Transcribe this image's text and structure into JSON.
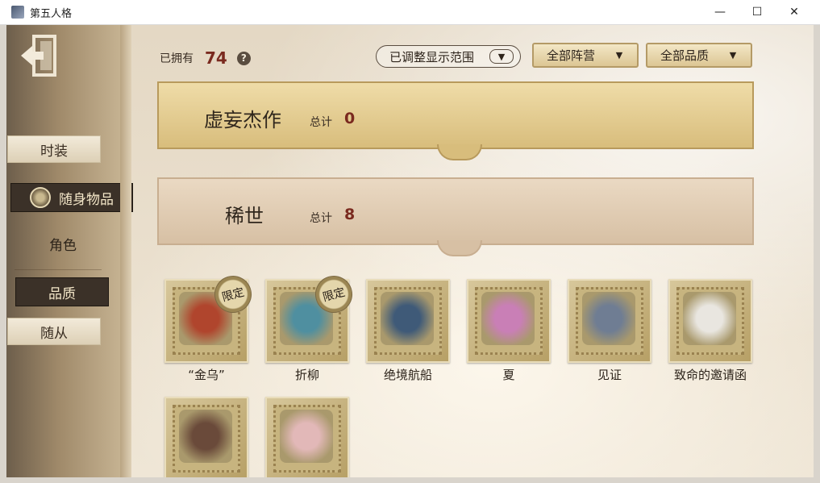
{
  "window": {
    "title": "第五人格",
    "minimize": "—",
    "maximize": "☐",
    "close": "✕"
  },
  "sidebar": {
    "items": [
      {
        "label": "时装"
      },
      {
        "label": "随身物品"
      },
      {
        "label": "角色"
      },
      {
        "label": "品质"
      },
      {
        "label": "随从"
      }
    ],
    "selected": "随身物品"
  },
  "header": {
    "owned_label": "已拥有",
    "owned_count": "74",
    "help_glyph": "?",
    "filters": [
      {
        "label": "已调整显示范围",
        "chevron": "▼"
      },
      {
        "label": "全部阵营",
        "chevron": "▼"
      },
      {
        "label": "全部品质",
        "chevron": "▼"
      }
    ]
  },
  "tiers": [
    {
      "name": "虚妄杰作",
      "total_label": "总计",
      "total": "0"
    },
    {
      "name": "稀世",
      "total_label": "总计",
      "total": "8"
    }
  ],
  "items": [
    {
      "name": "“金乌”",
      "badge": "限定",
      "color": "#b0452d"
    },
    {
      "name": "折柳",
      "badge": "限定",
      "color": "#4f8fa0"
    },
    {
      "name": "绝境航船",
      "badge": "",
      "color": "#3f5a78"
    },
    {
      "name": "夏",
      "badge": "",
      "color": "#c97fb6"
    },
    {
      "name": "见证",
      "badge": "",
      "color": "#6f7d93"
    },
    {
      "name": "致命的邀请函",
      "badge": "",
      "color": "#e9e6e0"
    },
    {
      "name": "",
      "badge": "",
      "color": "#6a4a3a"
    },
    {
      "name": "",
      "badge": "",
      "color": "#e2b8b8"
    }
  ],
  "colors": {
    "accent_red": "#7a2a1f",
    "gold": "#d8bd7c",
    "dark_tab": "#3b3128"
  }
}
